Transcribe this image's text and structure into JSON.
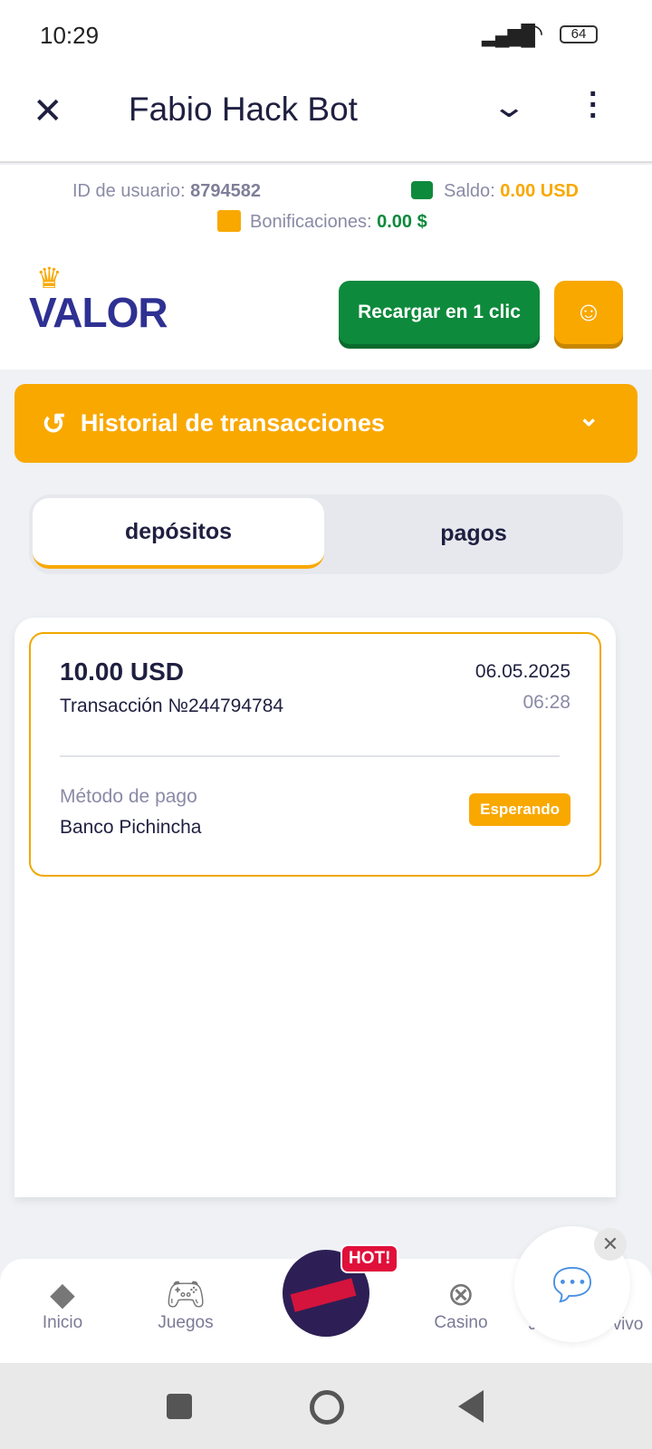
{
  "status": {
    "time": "10:29",
    "battery": "64"
  },
  "topbar": {
    "title": "Fabio Hack Bot"
  },
  "info": {
    "user_id_label": "ID de usuario:",
    "user_id": "8794582",
    "balance_label": "Saldo:",
    "balance": "0.00 USD",
    "bonus_label": "Bonificaciones:",
    "bonus": "0.00 $"
  },
  "header": {
    "logo": "VALOR",
    "recharge": "Recargar en 1 clic"
  },
  "history": {
    "title": "Historial de transacciones"
  },
  "tabs": [
    {
      "label": "depósitos"
    },
    {
      "label": "pagos"
    }
  ],
  "transaction": {
    "amount": "10.00 USD",
    "number": "Transacción №244794784",
    "date": "06.05.2025",
    "time": "06:28",
    "method_label": "Método de pago",
    "method": "Banco Pichincha",
    "status": "Esperando"
  },
  "nav": [
    {
      "label": "Inicio"
    },
    {
      "label": "Juegos"
    },
    {
      "label": "HOT!"
    },
    {
      "label": "Casino"
    },
    {
      "label": "Juegos en vivo"
    }
  ],
  "colors": {
    "accent": "#f9a800",
    "green": "#0e8a3c",
    "brand": "#2e3192"
  }
}
